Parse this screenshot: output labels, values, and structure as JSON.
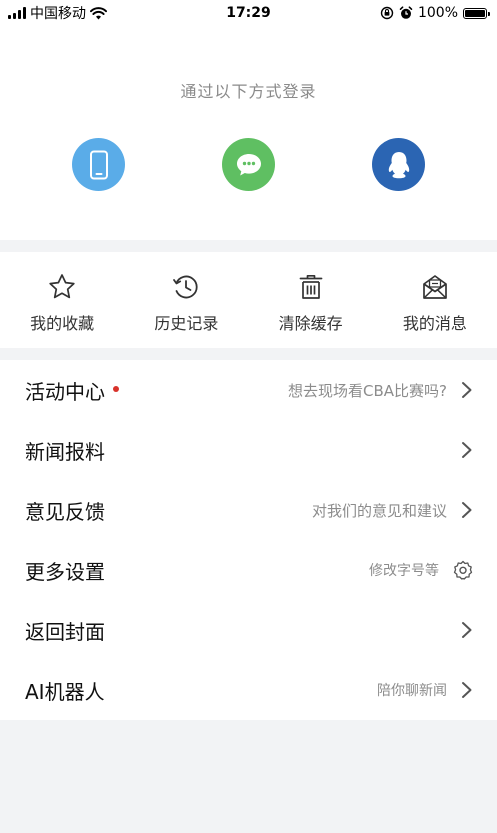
{
  "status_bar": {
    "carrier": "中国移动",
    "time": "17:29",
    "battery": "100%",
    "icons": [
      "signal-icon",
      "wifi-icon",
      "orientation-lock-icon",
      "alarm-icon",
      "battery-icon"
    ]
  },
  "login": {
    "title": "通过以下方式登录",
    "methods": [
      {
        "icon": "phone-icon",
        "color": "#5aace8"
      },
      {
        "icon": "wechat-icon",
        "color": "#5fbf62"
      },
      {
        "icon": "qq-icon",
        "color": "#2b65b3"
      }
    ]
  },
  "quick_actions": [
    {
      "label": "我的收藏",
      "icon": "star-icon"
    },
    {
      "label": "历史记录",
      "icon": "history-icon"
    },
    {
      "label": "清除缓存",
      "icon": "trash-icon"
    },
    {
      "label": "我的消息",
      "icon": "mail-icon"
    }
  ],
  "menu": [
    {
      "label": "活动中心",
      "hint": "想去现场看CBA比赛吗?",
      "badge": true,
      "icon": "chevron-right-icon"
    },
    {
      "label": "新闻报料",
      "hint": "",
      "icon": "chevron-right-icon"
    },
    {
      "label": "意见反馈",
      "hint": "对我们的意见和建议",
      "icon": "chevron-right-icon"
    },
    {
      "label": "更多设置",
      "hint": "修改字号等",
      "icon": "gear-icon"
    },
    {
      "label": "返回封面",
      "hint": "",
      "icon": "chevron-right-icon"
    },
    {
      "label": "AI机器人",
      "hint": "陪你聊新闻",
      "icon": "chevron-right-icon"
    }
  ],
  "colors": {
    "background": "#f2f3f5",
    "accent_red": "#d8322b",
    "hint_text": "#8c8c8c"
  }
}
